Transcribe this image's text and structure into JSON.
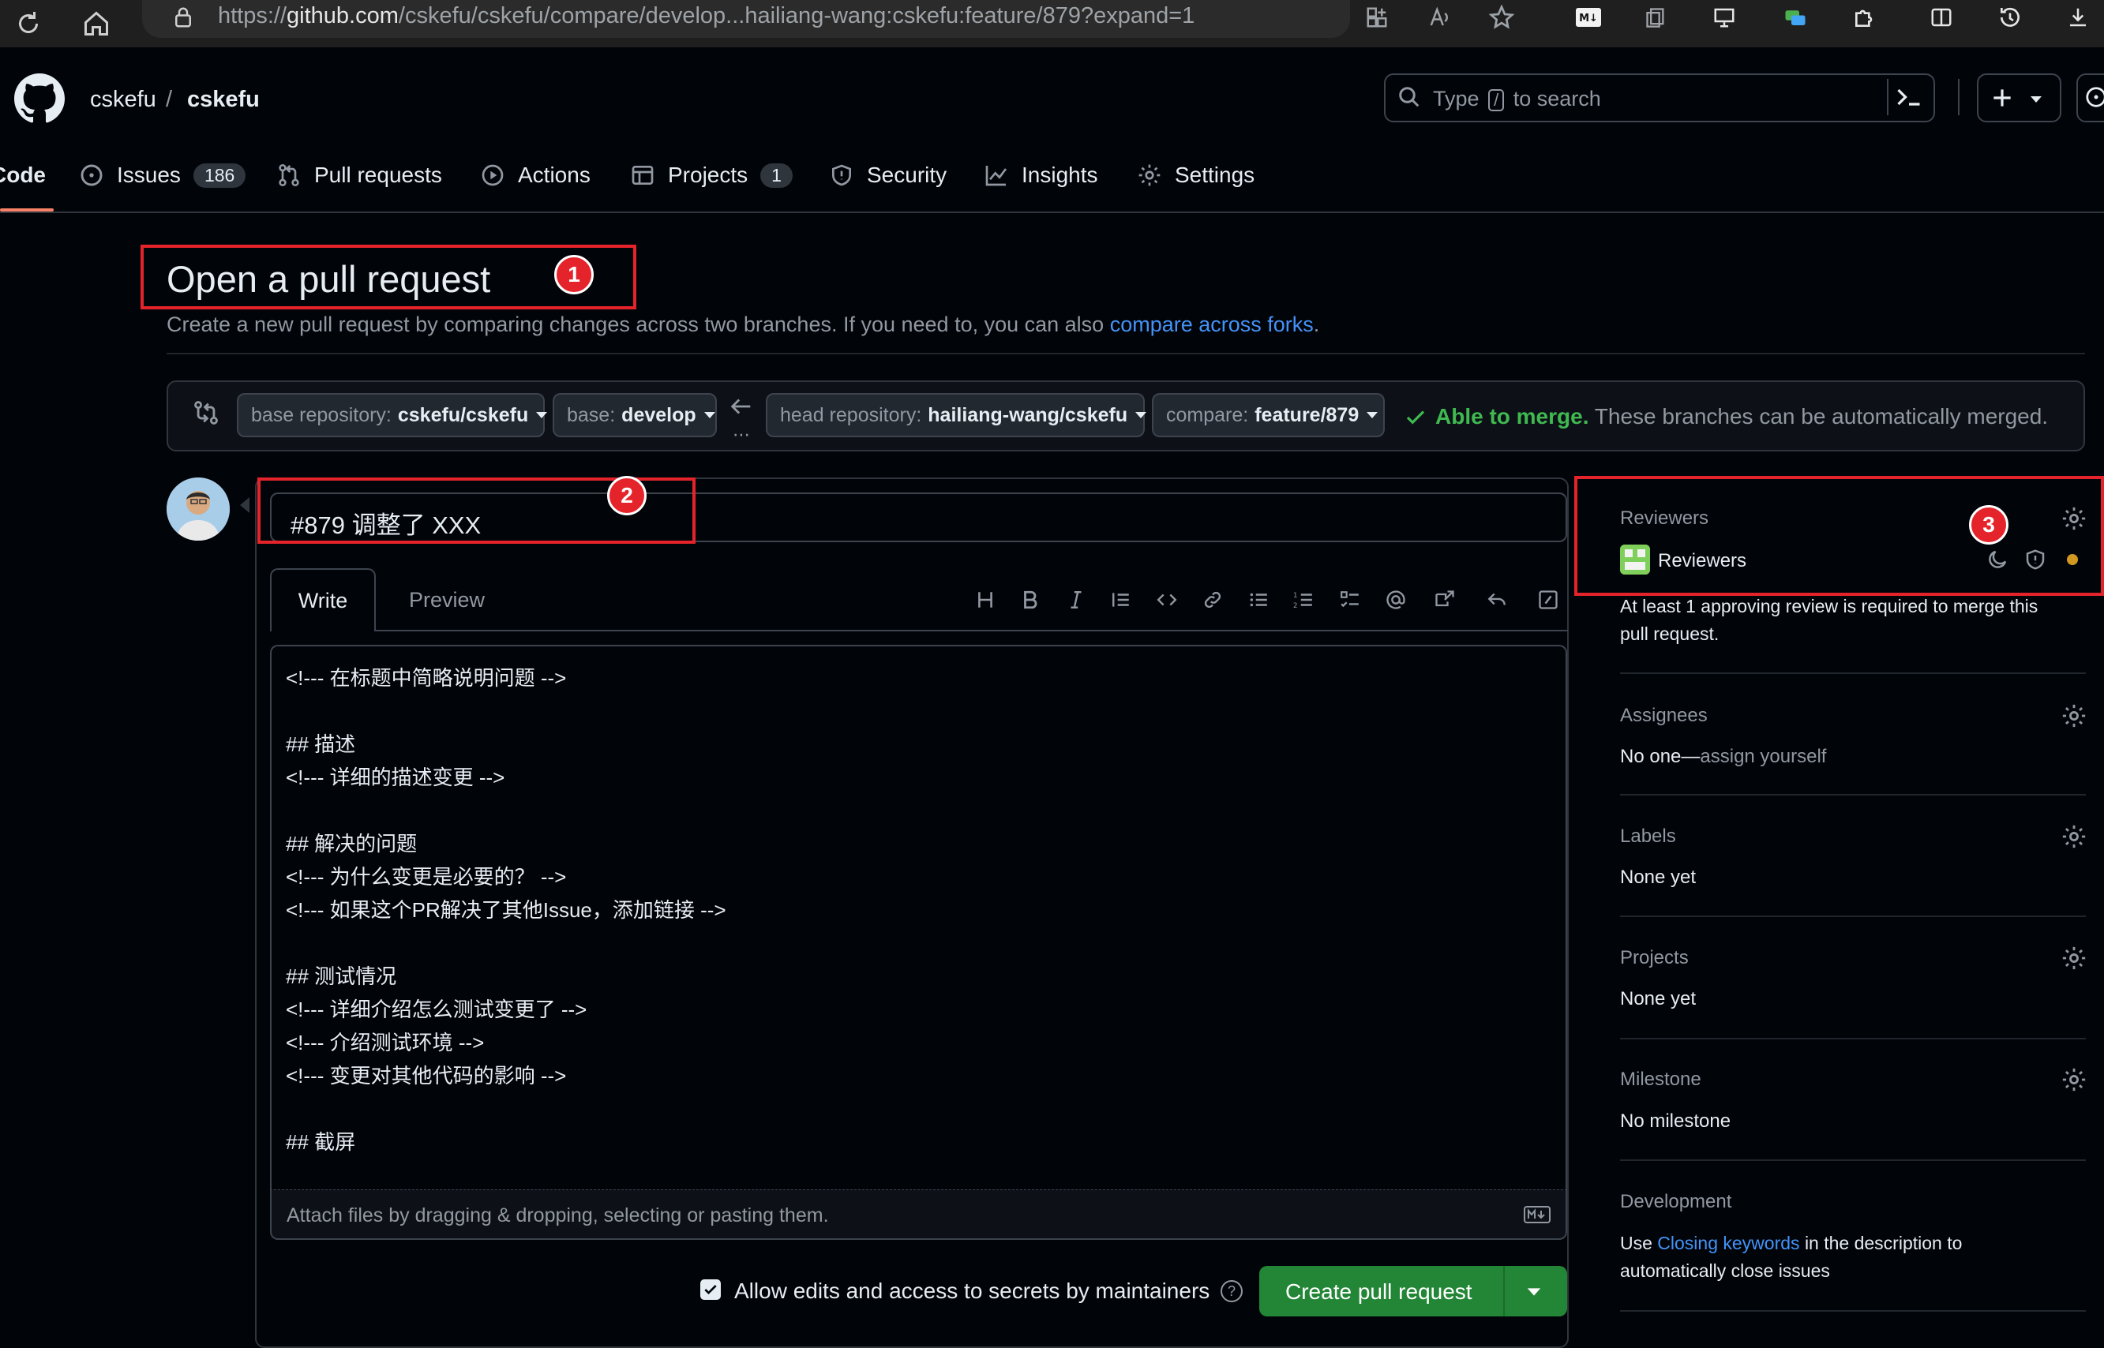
{
  "browser": {
    "url_prefix": "https://",
    "url_host": "github.com",
    "url_path": "/cskefu/cskefu/compare/develop...hailiang-wang:cskefu:feature/879?expand=1"
  },
  "header": {
    "owner": "cskefu",
    "separator": "/",
    "repo": "cskefu",
    "search_type": "Type",
    "search_key": "/",
    "search_rest": "to search"
  },
  "nav": {
    "code": "Code",
    "issues": "Issues",
    "issues_count": "186",
    "pulls": "Pull requests",
    "actions": "Actions",
    "projects": "Projects",
    "projects_count": "1",
    "security": "Security",
    "insights": "Insights",
    "settings": "Settings"
  },
  "page": {
    "title": "Open a pull request",
    "subtitle": "Create a new pull request by comparing changes across two branches. If you need to, you can also",
    "subtitle_link": "compare across forks",
    "subtitle_end": "."
  },
  "annotations": {
    "one": "1",
    "two": "2",
    "three": "3"
  },
  "compare": {
    "base_repo_label": "base repository:",
    "base_repo_value": "cskefu/cskefu",
    "base_label": "base:",
    "base_value": "develop",
    "head_repo_label": "head repository:",
    "head_repo_value": "hailiang-wang/cskefu",
    "compare_label": "compare:",
    "compare_value": "feature/879",
    "merge_ok": "Able to merge.",
    "merge_text": "These branches can be automatically merged."
  },
  "editor": {
    "title_value": "#879 调整了 XXX",
    "tab_write": "Write",
    "tab_preview": "Preview",
    "body": "<!--- 在标题中简略说明问题 -->\n\n## 描述\n<!--- 详细的描述变更 -->\n\n## 解决的问题\n<!--- 为什么变更是必要的？ -->\n<!--- 如果这个PR解决了其他Issue，添加链接 -->\n\n## 测试情况\n<!--- 详细介绍怎么测试变更了 -->\n<!--- 介绍测试环境 -->\n<!--- 变更对其他代码的影响 -->\n\n## 截屏",
    "attach_hint": "Attach files by dragging & dropping, selecting or pasting them.",
    "allow_edits": "Allow edits and access to secrets by maintainers",
    "create_button": "Create pull request"
  },
  "sidebar": {
    "reviewers_title": "Reviewers",
    "reviewers_team": "Reviewers",
    "reviewers_note_1": "At least 1 approving review is required to merge this",
    "reviewers_note_2": "pull request.",
    "assignees_title": "Assignees",
    "assignees_none": "No one—",
    "assignees_link": "assign yourself",
    "labels_title": "Labels",
    "labels_value": "None yet",
    "projects_title": "Projects",
    "projects_value": "None yet",
    "milestone_title": "Milestone",
    "milestone_value": "No milestone",
    "development_title": "Development",
    "development_use": "Use",
    "development_link": "Closing keywords",
    "development_rest": "in the description to",
    "development_line2": "automatically close issues"
  },
  "colors": {
    "accent_green": "#238636",
    "link_blue": "#4493f8",
    "annotation_red": "#e5232b",
    "merge_green": "#3fb950"
  }
}
